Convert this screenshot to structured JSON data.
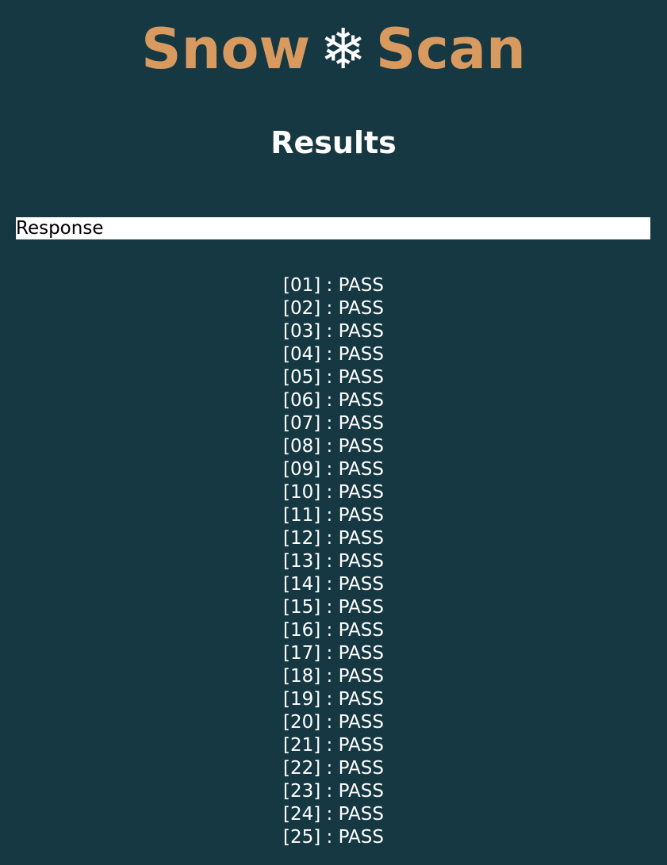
{
  "header": {
    "title_left": "Snow",
    "title_icon": "❄",
    "title_right": "Scan"
  },
  "section": {
    "title": "Results"
  },
  "response": {
    "label": "Response"
  },
  "results": [
    "[01] : PASS",
    "[02] : PASS",
    "[03] : PASS",
    "[04] : PASS",
    "[05] : PASS",
    "[06] : PASS",
    "[07] : PASS",
    "[08] : PASS",
    "[09] : PASS",
    "[10] : PASS",
    "[11] : PASS",
    "[12] : PASS",
    "[13] : PASS",
    "[14] : PASS",
    "[15] : PASS",
    "[16] : PASS",
    "[17] : PASS",
    "[18] : PASS",
    "[19] : PASS",
    "[20] : PASS",
    "[21] : PASS",
    "[22] : PASS",
    "[23] : PASS",
    "[24] : PASS",
    "[25] : PASS"
  ],
  "colors": {
    "background": "#163843",
    "title_accent": "#d99a5f",
    "text": "#ffffff"
  }
}
